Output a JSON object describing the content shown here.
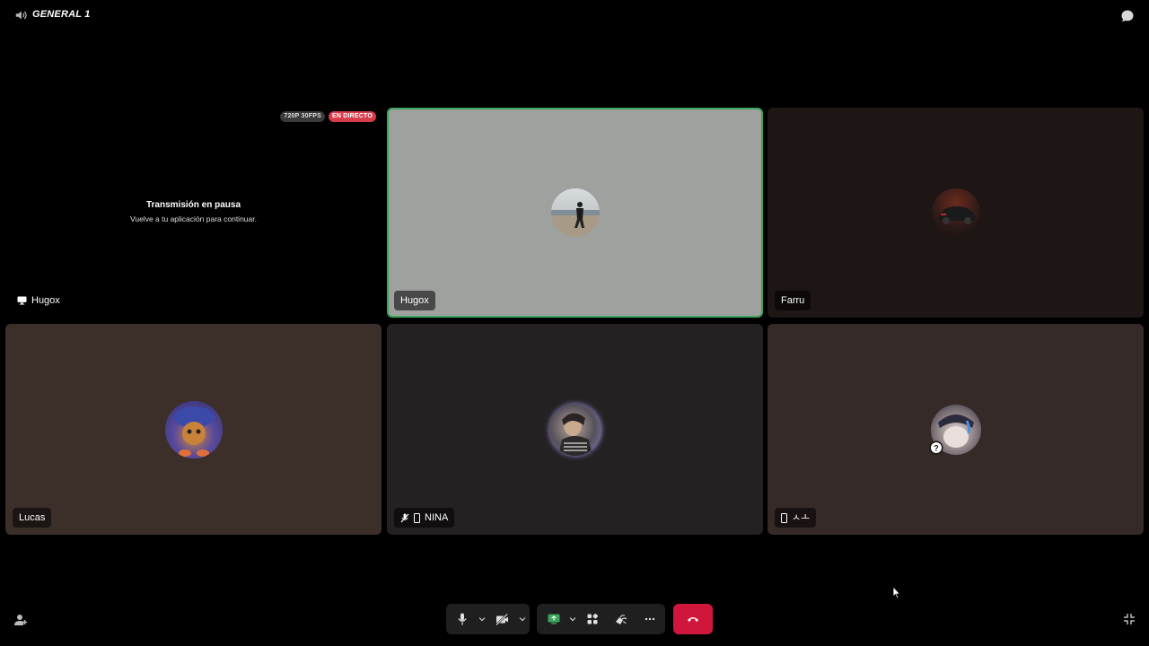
{
  "topbar": {
    "channel_icon": "speaker-icon",
    "channel_name": "GENERAL 1",
    "chat_icon": "chat-bubble-icon"
  },
  "tiles": [
    {
      "name": "Hugox",
      "type": "screen-share",
      "name_icon": "monitor-icon",
      "badges": {
        "resolution": "720P 30FPS",
        "live": "EN DIRECTO"
      },
      "paused_title": "Transmisión en pausa",
      "paused_subtitle": "Vuelve a tu aplicación para continuar.",
      "background": "#000000"
    },
    {
      "name": "Hugox",
      "type": "participant",
      "speaking": true,
      "background": "#9fa19f",
      "border": "#3ba55c"
    },
    {
      "name": "Farru",
      "type": "participant",
      "background": "#1e1615"
    },
    {
      "name": "Lucas",
      "type": "participant",
      "background": "#3c2f2a"
    },
    {
      "name": "NINA",
      "type": "participant",
      "background": "#252123",
      "name_icons": [
        "muted-mic-icon",
        "mobile-icon"
      ]
    },
    {
      "name": "ㅅㅗ",
      "type": "participant",
      "background": "#352a28",
      "name_icons": [
        "mobile-icon"
      ],
      "avatar_badge": "question-icon"
    }
  ],
  "controls": {
    "mic": "microphone-icon",
    "camera": "camera-off-icon",
    "screen_share": "screen-share-icon",
    "activities": "activities-icon",
    "soundboard": "soundboard-icon",
    "more": "more-icon",
    "hangup": "hangup-icon",
    "invite": "add-person-icon",
    "fullscreen": "exit-fullscreen-icon"
  },
  "colors": {
    "accent_green": "#3ba55c",
    "hangup_red": "#d0163a",
    "live_red": "#d83c4a"
  }
}
